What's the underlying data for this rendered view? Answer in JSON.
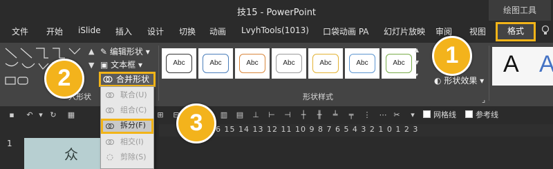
{
  "titlebar": {
    "title": "技15 - PowerPoint",
    "context_group": "绘图工具"
  },
  "tabs": [
    {
      "label": "文件"
    },
    {
      "label": "开始"
    },
    {
      "label": "iSlide"
    },
    {
      "label": "插入"
    },
    {
      "label": "设计"
    },
    {
      "label": "切换"
    },
    {
      "label": "动画"
    },
    {
      "label": "LvyhTools(1013)"
    },
    {
      "label": "口袋动画 PA"
    },
    {
      "label": "幻灯片放映"
    },
    {
      "label": "审阅"
    },
    {
      "label": "视图"
    },
    {
      "label": "格式"
    }
  ],
  "ribbon": {
    "insert_shapes_label": "入形状",
    "edit_shape": "编辑形状",
    "text_box": "文本框",
    "merge_shapes": "合并形状",
    "shape_styles_label": "形状样式",
    "shape_effects": "形状效果",
    "style_sample_text": "Abc",
    "style_borders": [
      "#333333",
      "#4a7ebb",
      "#d8863a",
      "#9a9a9a",
      "#e3b234",
      "#5b95d0",
      "#78ac48"
    ],
    "wordart_letters": [
      "A",
      "A"
    ]
  },
  "merge_menu": {
    "items": [
      {
        "label": "联合(U)",
        "state": "disabled"
      },
      {
        "label": "组合(C)",
        "state": "disabled"
      },
      {
        "label": "拆分(F)",
        "state": "highlighted"
      },
      {
        "label": "相交(I)",
        "state": "disabled"
      },
      {
        "label": "剪除(S)",
        "state": "disabled"
      }
    ]
  },
  "qat": {
    "gridlines": "网格线",
    "guides": "参考线"
  },
  "ruler": {
    "ticks": "6 15 14 13 12 11 10 9 8 7 6 5 4 3 2 1 0 1 2 3"
  },
  "slides": {
    "current_number": "1",
    "thumb_text": "众"
  },
  "callouts": [
    "1",
    "2",
    "3"
  ],
  "colors": {
    "accent": "#f2b418",
    "ribbon_bg": "#444444",
    "title_bg": "#2b2b2b"
  }
}
